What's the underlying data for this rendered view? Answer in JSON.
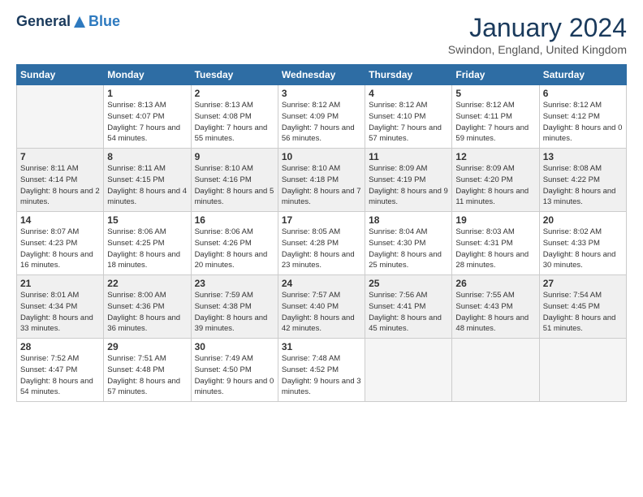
{
  "logo": {
    "general": "General",
    "blue": "Blue"
  },
  "title": {
    "month_year": "January 2024",
    "location": "Swindon, England, United Kingdom"
  },
  "days_of_week": [
    "Sunday",
    "Monday",
    "Tuesday",
    "Wednesday",
    "Thursday",
    "Friday",
    "Saturday"
  ],
  "weeks": [
    [
      {
        "day": "",
        "sunrise": "",
        "sunset": "",
        "daylight": "",
        "empty": true
      },
      {
        "day": "1",
        "sunrise": "Sunrise: 8:13 AM",
        "sunset": "Sunset: 4:07 PM",
        "daylight": "Daylight: 7 hours and 54 minutes."
      },
      {
        "day": "2",
        "sunrise": "Sunrise: 8:13 AM",
        "sunset": "Sunset: 4:08 PM",
        "daylight": "Daylight: 7 hours and 55 minutes."
      },
      {
        "day": "3",
        "sunrise": "Sunrise: 8:12 AM",
        "sunset": "Sunset: 4:09 PM",
        "daylight": "Daylight: 7 hours and 56 minutes."
      },
      {
        "day": "4",
        "sunrise": "Sunrise: 8:12 AM",
        "sunset": "Sunset: 4:10 PM",
        "daylight": "Daylight: 7 hours and 57 minutes."
      },
      {
        "day": "5",
        "sunrise": "Sunrise: 8:12 AM",
        "sunset": "Sunset: 4:11 PM",
        "daylight": "Daylight: 7 hours and 59 minutes."
      },
      {
        "day": "6",
        "sunrise": "Sunrise: 8:12 AM",
        "sunset": "Sunset: 4:12 PM",
        "daylight": "Daylight: 8 hours and 0 minutes."
      }
    ],
    [
      {
        "day": "7",
        "sunrise": "Sunrise: 8:11 AM",
        "sunset": "Sunset: 4:14 PM",
        "daylight": "Daylight: 8 hours and 2 minutes."
      },
      {
        "day": "8",
        "sunrise": "Sunrise: 8:11 AM",
        "sunset": "Sunset: 4:15 PM",
        "daylight": "Daylight: 8 hours and 4 minutes."
      },
      {
        "day": "9",
        "sunrise": "Sunrise: 8:10 AM",
        "sunset": "Sunset: 4:16 PM",
        "daylight": "Daylight: 8 hours and 5 minutes."
      },
      {
        "day": "10",
        "sunrise": "Sunrise: 8:10 AM",
        "sunset": "Sunset: 4:18 PM",
        "daylight": "Daylight: 8 hours and 7 minutes."
      },
      {
        "day": "11",
        "sunrise": "Sunrise: 8:09 AM",
        "sunset": "Sunset: 4:19 PM",
        "daylight": "Daylight: 8 hours and 9 minutes."
      },
      {
        "day": "12",
        "sunrise": "Sunrise: 8:09 AM",
        "sunset": "Sunset: 4:20 PM",
        "daylight": "Daylight: 8 hours and 11 minutes."
      },
      {
        "day": "13",
        "sunrise": "Sunrise: 8:08 AM",
        "sunset": "Sunset: 4:22 PM",
        "daylight": "Daylight: 8 hours and 13 minutes."
      }
    ],
    [
      {
        "day": "14",
        "sunrise": "Sunrise: 8:07 AM",
        "sunset": "Sunset: 4:23 PM",
        "daylight": "Daylight: 8 hours and 16 minutes."
      },
      {
        "day": "15",
        "sunrise": "Sunrise: 8:06 AM",
        "sunset": "Sunset: 4:25 PM",
        "daylight": "Daylight: 8 hours and 18 minutes."
      },
      {
        "day": "16",
        "sunrise": "Sunrise: 8:06 AM",
        "sunset": "Sunset: 4:26 PM",
        "daylight": "Daylight: 8 hours and 20 minutes."
      },
      {
        "day": "17",
        "sunrise": "Sunrise: 8:05 AM",
        "sunset": "Sunset: 4:28 PM",
        "daylight": "Daylight: 8 hours and 23 minutes."
      },
      {
        "day": "18",
        "sunrise": "Sunrise: 8:04 AM",
        "sunset": "Sunset: 4:30 PM",
        "daylight": "Daylight: 8 hours and 25 minutes."
      },
      {
        "day": "19",
        "sunrise": "Sunrise: 8:03 AM",
        "sunset": "Sunset: 4:31 PM",
        "daylight": "Daylight: 8 hours and 28 minutes."
      },
      {
        "day": "20",
        "sunrise": "Sunrise: 8:02 AM",
        "sunset": "Sunset: 4:33 PM",
        "daylight": "Daylight: 8 hours and 30 minutes."
      }
    ],
    [
      {
        "day": "21",
        "sunrise": "Sunrise: 8:01 AM",
        "sunset": "Sunset: 4:34 PM",
        "daylight": "Daylight: 8 hours and 33 minutes."
      },
      {
        "day": "22",
        "sunrise": "Sunrise: 8:00 AM",
        "sunset": "Sunset: 4:36 PM",
        "daylight": "Daylight: 8 hours and 36 minutes."
      },
      {
        "day": "23",
        "sunrise": "Sunrise: 7:59 AM",
        "sunset": "Sunset: 4:38 PM",
        "daylight": "Daylight: 8 hours and 39 minutes."
      },
      {
        "day": "24",
        "sunrise": "Sunrise: 7:57 AM",
        "sunset": "Sunset: 4:40 PM",
        "daylight": "Daylight: 8 hours and 42 minutes."
      },
      {
        "day": "25",
        "sunrise": "Sunrise: 7:56 AM",
        "sunset": "Sunset: 4:41 PM",
        "daylight": "Daylight: 8 hours and 45 minutes."
      },
      {
        "day": "26",
        "sunrise": "Sunrise: 7:55 AM",
        "sunset": "Sunset: 4:43 PM",
        "daylight": "Daylight: 8 hours and 48 minutes."
      },
      {
        "day": "27",
        "sunrise": "Sunrise: 7:54 AM",
        "sunset": "Sunset: 4:45 PM",
        "daylight": "Daylight: 8 hours and 51 minutes."
      }
    ],
    [
      {
        "day": "28",
        "sunrise": "Sunrise: 7:52 AM",
        "sunset": "Sunset: 4:47 PM",
        "daylight": "Daylight: 8 hours and 54 minutes."
      },
      {
        "day": "29",
        "sunrise": "Sunrise: 7:51 AM",
        "sunset": "Sunset: 4:48 PM",
        "daylight": "Daylight: 8 hours and 57 minutes."
      },
      {
        "day": "30",
        "sunrise": "Sunrise: 7:49 AM",
        "sunset": "Sunset: 4:50 PM",
        "daylight": "Daylight: 9 hours and 0 minutes."
      },
      {
        "day": "31",
        "sunrise": "Sunrise: 7:48 AM",
        "sunset": "Sunset: 4:52 PM",
        "daylight": "Daylight: 9 hours and 3 minutes."
      },
      {
        "day": "",
        "sunrise": "",
        "sunset": "",
        "daylight": "",
        "empty": true
      },
      {
        "day": "",
        "sunrise": "",
        "sunset": "",
        "daylight": "",
        "empty": true
      },
      {
        "day": "",
        "sunrise": "",
        "sunset": "",
        "daylight": "",
        "empty": true
      }
    ]
  ]
}
